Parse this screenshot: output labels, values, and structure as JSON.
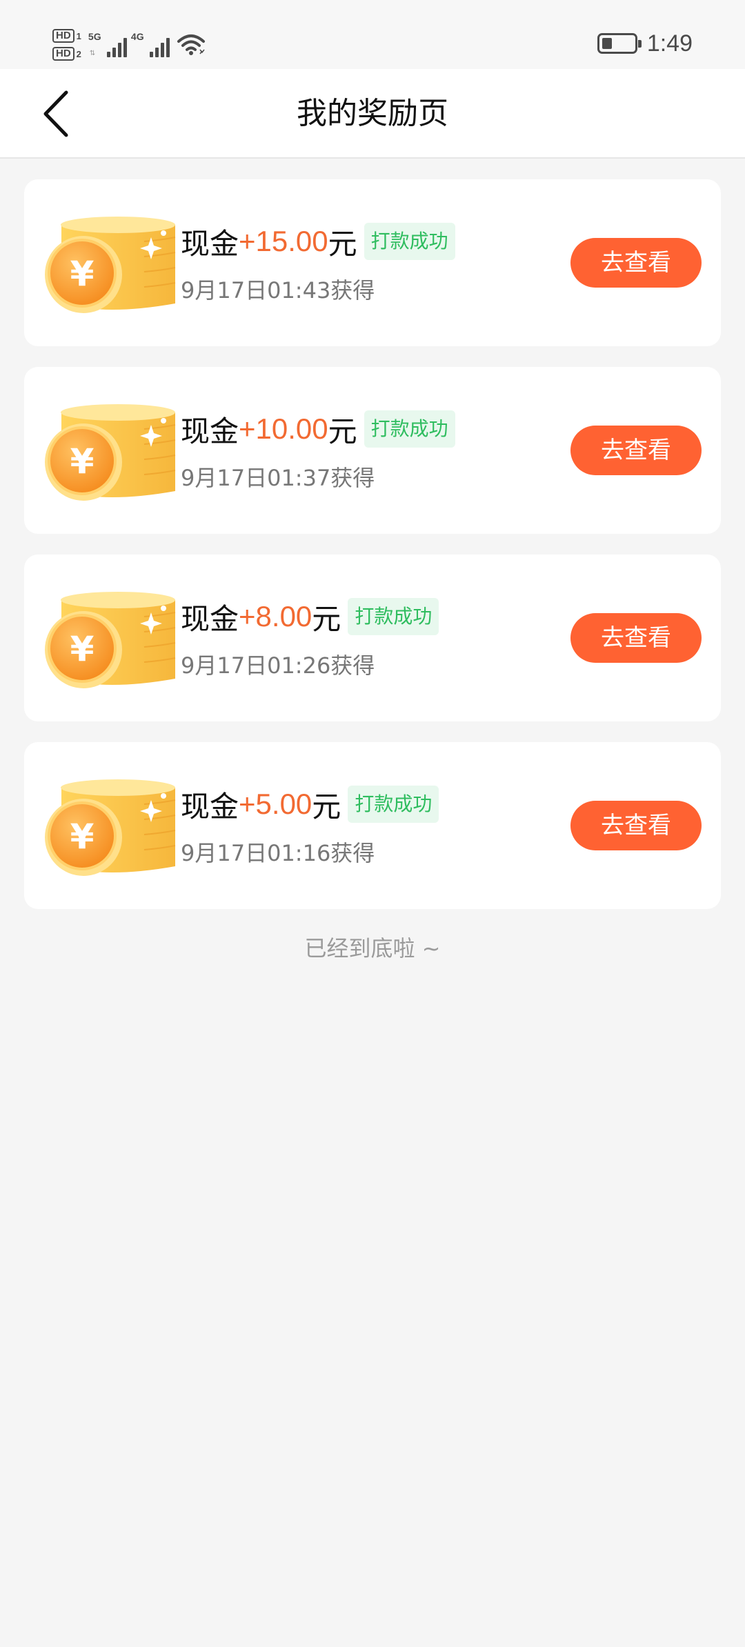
{
  "status_bar": {
    "sim1_label": "HD",
    "sim1_num": "1",
    "sim2_label": "HD",
    "sim2_num": "2",
    "net1": "5G",
    "net2": "4G",
    "time": "1:49",
    "icons": [
      "signal-icon",
      "wifi-icon",
      "battery-icon"
    ]
  },
  "nav": {
    "title": "我的奖励页",
    "back_icon": "chevron-left-icon"
  },
  "rewards": [
    {
      "prefix": "现金",
      "amount": "+15.00",
      "suffix": "元",
      "status": "打款成功",
      "time": "9月17日01:43获得",
      "button": "去查看"
    },
    {
      "prefix": "现金",
      "amount": "+10.00",
      "suffix": "元",
      "status": "打款成功",
      "time": "9月17日01:37获得",
      "button": "去查看"
    },
    {
      "prefix": "现金",
      "amount": "+8.00",
      "suffix": "元",
      "status": "打款成功",
      "time": "9月17日01:26获得",
      "button": "去查看"
    },
    {
      "prefix": "现金",
      "amount": "+5.00",
      "suffix": "元",
      "status": "打款成功",
      "time": "9月17日01:16获得",
      "button": "去查看"
    }
  ],
  "footer": {
    "end_text": "已经到底啦 ~"
  },
  "colors": {
    "accent": "#ff6232",
    "amount": "#f26a32",
    "success_text": "#2fbd5f",
    "success_bg": "#e8f8ee",
    "background": "#f5f5f5"
  }
}
